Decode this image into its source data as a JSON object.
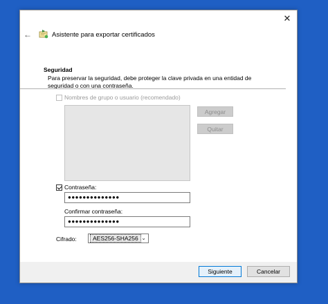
{
  "window": {
    "title": "Asistente para exportar certificados",
    "close_glyph": "✕",
    "back_glyph": "←",
    "icon": "certificate-wizard-icon"
  },
  "security": {
    "section_title": "Seguridad",
    "description": "Para preservar la seguridad, debe proteger la clave privada en una entidad de seguridad o con una contraseña.",
    "group_checkbox_label": "Nombres de grupo o usuario (recomendado)",
    "group_checkbox_checked": false,
    "add_button": "Agregar",
    "remove_button": "Quitar"
  },
  "password": {
    "checkbox_label": "Contraseña:",
    "checkbox_checked": true,
    "value": "●●●●●●●●●●●●●●",
    "confirm_label": "Confirmar contraseña:",
    "confirm_value": "●●●●●●●●●●●●●●"
  },
  "encryption": {
    "label": "Cifrado:",
    "selected": "AES256-SHA256"
  },
  "footer": {
    "next_button": "Siguiente",
    "cancel_button": "Cancelar"
  }
}
